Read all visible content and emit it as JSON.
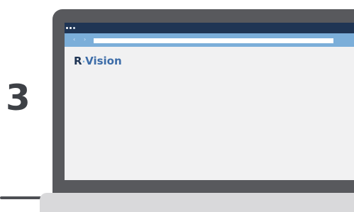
{
  "step": {
    "number": "3"
  },
  "browser": {
    "nav": {
      "back_glyph": "‹",
      "forward_glyph": "›"
    },
    "address": ""
  },
  "page": {
    "logo": {
      "r": "R",
      "sep": "·",
      "vision": "Vision"
    }
  },
  "colors": {
    "laptop_frame": "#58595d",
    "laptop_base": "#d9d9db",
    "titlebar": "#1f3554",
    "toolbar": "#7baed9",
    "screen_background": "#f1f1f2",
    "step_number": "#3e4146",
    "logo_dark": "#1f3554",
    "logo_blue": "#3c6ca8"
  }
}
